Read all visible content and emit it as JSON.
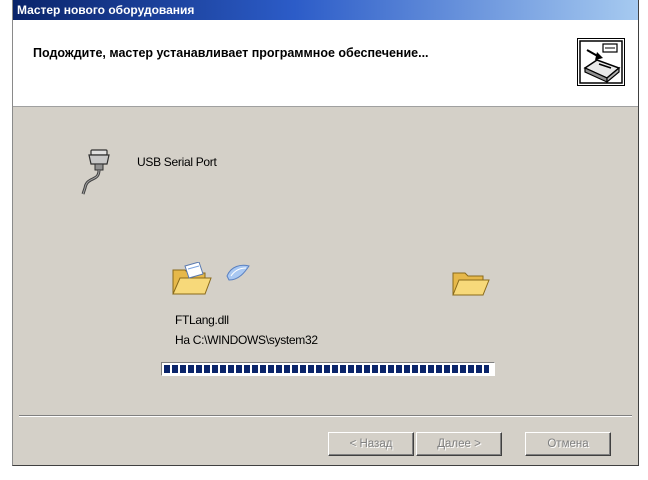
{
  "window": {
    "title": "Мастер нового оборудования"
  },
  "header": {
    "title": "Подождите, мастер устанавливает программное обеспечение...",
    "icon": "hardware-wizard-icon"
  },
  "device": {
    "icon": "serial-cable-icon",
    "name": "USB Serial Port"
  },
  "copy": {
    "source_icon": "open-folder-icon",
    "paper_icon": "flying-paper-icon",
    "dest_icon": "folder-icon",
    "file_name": "FTLang.dll",
    "destination": "На C:\\WINDOWS\\system32",
    "progress_fraction": 0.99
  },
  "buttons": {
    "back_label": "< Назад",
    "next_label": "Далее >",
    "cancel_label": "Отмена",
    "enabled": false
  },
  "colors": {
    "titlebar_start": "#0a246a",
    "titlebar_end": "#a6caf0",
    "dialog_bg": "#d4d0c8",
    "progress_block": "#0a246a",
    "folder_yellow": "#f5d36b"
  }
}
